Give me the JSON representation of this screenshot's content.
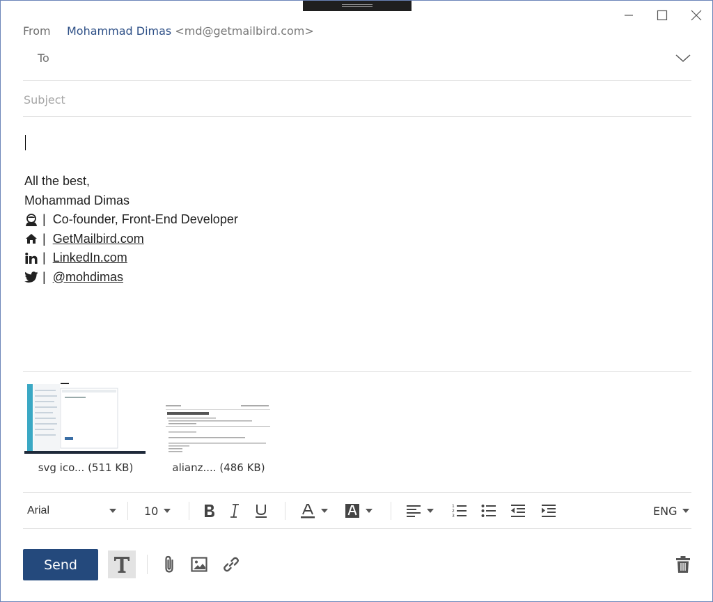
{
  "window": {
    "controls": [
      "minimize-icon",
      "maximize-icon",
      "close-icon"
    ]
  },
  "header": {
    "from_label": "From",
    "from_name": "Mohammad Dimas",
    "from_email": "<md@getmailbird.com>",
    "to_label": "To",
    "subject_placeholder": "Subject"
  },
  "body": {
    "signature": {
      "closing": "All the best,",
      "name": "Mohammad Dimas",
      "separator": "|",
      "role": "Co-founder, Front-End Developer",
      "website": "GetMailbird.com",
      "linkedin": "LinkedIn.com",
      "twitter": "@mohdimas"
    }
  },
  "attachments": [
    {
      "caption": "svg ico... (511 KB)"
    },
    {
      "caption": "alianz.... (486 KB)"
    }
  ],
  "format_bar": {
    "font": "Arial",
    "size": "10",
    "language": "ENG",
    "icons": [
      "bold-icon",
      "italic-icon",
      "underline-icon",
      "font-color-icon",
      "highlight-color-icon",
      "align-icon",
      "numbered-list-icon",
      "bullet-list-icon",
      "outdent-icon",
      "indent-icon"
    ]
  },
  "actions": {
    "send_label": "Send",
    "icons": [
      "text-format-icon",
      "attach-icon",
      "insert-image-icon",
      "insert-link-icon",
      "trash-icon"
    ]
  },
  "colors": {
    "accent": "#24497c",
    "from_name": "#2d4f86",
    "window_border": "#6b84b8"
  }
}
